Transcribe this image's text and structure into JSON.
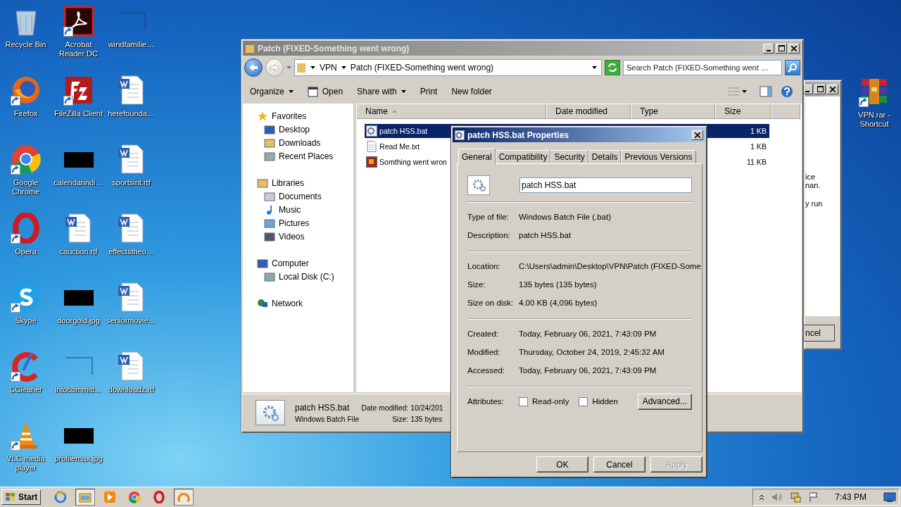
{
  "desktop": {
    "icons": [
      {
        "label": "Recycle Bin",
        "kind": "recycle",
        "shortcut": false
      },
      {
        "label": "Firefox",
        "kind": "firefox",
        "shortcut": true
      },
      {
        "label": "Google Chrome",
        "kind": "chrome",
        "shortcut": true
      },
      {
        "label": "Opera",
        "kind": "opera",
        "shortcut": true
      },
      {
        "label": "Skype",
        "kind": "skype",
        "shortcut": true
      },
      {
        "label": "CCleaner",
        "kind": "ccleaner",
        "shortcut": true
      },
      {
        "label": "VLC media player",
        "kind": "vlc",
        "shortcut": true
      },
      {
        "label": "Acrobat Reader DC",
        "kind": "acrobat",
        "shortcut": true
      },
      {
        "label": "FileZilla Client",
        "kind": "filezilla",
        "shortcut": true
      },
      {
        "label": "calendarindi…",
        "kind": "image",
        "shortcut": false
      },
      {
        "label": "cauction.rtf",
        "kind": "word",
        "shortcut": false
      },
      {
        "label": "doorgold.jpg",
        "kind": "image",
        "shortcut": false
      },
      {
        "label": "intocommitt…",
        "kind": "blank",
        "shortcut": false
      },
      {
        "label": "profilemax.jpg",
        "kind": "image",
        "shortcut": false
      },
      {
        "label": "windfamilie…",
        "kind": "blank",
        "shortcut": false
      },
      {
        "label": "herefounda…",
        "kind": "word",
        "shortcut": false
      },
      {
        "label": "sportsint.rtf",
        "kind": "word",
        "shortcut": false
      },
      {
        "label": "effectstheo…",
        "kind": "word",
        "shortcut": false
      },
      {
        "label": "seniormovie…",
        "kind": "word",
        "shortcut": false
      },
      {
        "label": "downloadz.rtf",
        "kind": "word",
        "shortcut": false
      }
    ],
    "right_icons": [
      {
        "label": "VPN.rar - Shortcut",
        "kind": "winrar",
        "shortcut": true
      }
    ]
  },
  "background_window": {
    "paragraphs": [
      [
        "ice",
        "nan."
      ],
      [
        "y run"
      ]
    ],
    "button": "ncel"
  },
  "explorer": {
    "title": "Patch (FIXED-Something went wrong)",
    "breadcrumb": [
      "VPN",
      "Patch (FIXED-Something went wrong)"
    ],
    "search": {
      "placeholder": "Search Patch (FIXED-Something went …"
    },
    "toolbar": [
      {
        "label": "Organize",
        "kind": "menu"
      },
      {
        "label": "Open",
        "kind": "icon"
      },
      {
        "label": "Share with",
        "kind": "menu"
      },
      {
        "label": "Print",
        "kind": "plain"
      },
      {
        "label": "New folder",
        "kind": "plain"
      }
    ],
    "nav": [
      {
        "label": "Favorites",
        "kind": "star",
        "children": [
          {
            "label": "Desktop",
            "kind": "desktop"
          },
          {
            "label": "Downloads",
            "kind": "downloads"
          },
          {
            "label": "Recent Places",
            "kind": "recent"
          }
        ]
      },
      {
        "label": "Libraries",
        "kind": "libraries",
        "children": [
          {
            "label": "Documents",
            "kind": "documents"
          },
          {
            "label": "Music",
            "kind": "music"
          },
          {
            "label": "Pictures",
            "kind": "pictures"
          },
          {
            "label": "Videos",
            "kind": "videos"
          }
        ]
      },
      {
        "label": "Computer",
        "kind": "computer",
        "children": [
          {
            "label": "Local Disk (C:)",
            "kind": "disk"
          }
        ]
      },
      {
        "label": "Network",
        "kind": "network"
      }
    ],
    "columns": [
      {
        "label": "Name",
        "sorted": true
      },
      {
        "label": "Date modified",
        "sorted": false
      },
      {
        "label": "Type",
        "sorted": false
      },
      {
        "label": "Size",
        "sorted": false
      }
    ],
    "files": [
      {
        "name": "patch HSS.bat",
        "size": "1 KB",
        "kind": "batch",
        "selected": true
      },
      {
        "name": "Read Me.txt",
        "size": "1 KB",
        "kind": "text",
        "selected": false
      },
      {
        "name": "Somthing went wron",
        "size": "11 KB",
        "kind": "media",
        "selected": false
      }
    ],
    "details": {
      "name": "patch HSS.bat",
      "type": "Windows Batch File",
      "fields": [
        {
          "label": "Date modified:",
          "value": "10/24/201"
        },
        {
          "label": "Size:",
          "value": "135 bytes"
        }
      ]
    }
  },
  "dialog": {
    "title": "patch HSS.bat Properties",
    "tabs": [
      {
        "label": "General",
        "selected": true
      },
      {
        "label": "Compatibility",
        "selected": false
      },
      {
        "label": "Security",
        "selected": false
      },
      {
        "label": "Details",
        "selected": false
      },
      {
        "label": "Previous Versions",
        "selected": false
      }
    ],
    "filename": "patch HSS.bat",
    "groups": [
      [
        {
          "label": "Type of file:",
          "value": "Windows Batch File (.bat)"
        },
        {
          "label": "Description:",
          "value": "patch HSS.bat"
        }
      ],
      [
        {
          "label": "Location:",
          "value": "C:\\Users\\admin\\Desktop\\VPN\\Patch (FIXED-Some"
        },
        {
          "label": "Size:",
          "value": "135 bytes (135 bytes)"
        },
        {
          "label": "Size on disk:",
          "value": "4.00 KB (4,096 bytes)"
        }
      ],
      [
        {
          "label": "Created:",
          "value": "Today, February 06, 2021, 7:43:09 PM"
        },
        {
          "label": "Modified:",
          "value": "Thursday, October 24, 2019, 2:45:32 AM"
        },
        {
          "label": "Accessed:",
          "value": "Today, February 06, 2021, 7:43:09 PM"
        }
      ]
    ],
    "attributes": {
      "label": "Attributes:",
      "checks": [
        {
          "label": "Read-only",
          "checked": false
        },
        {
          "label": "Hidden",
          "checked": false
        }
      ],
      "button": "Advanced..."
    },
    "buttons": [
      {
        "label": "OK",
        "disabled": false
      },
      {
        "label": "Cancel",
        "disabled": false
      },
      {
        "label": "Apply",
        "disabled": true
      }
    ]
  },
  "taskbar": {
    "start": "Start",
    "apps": [
      {
        "kind": "ie",
        "selected": false
      },
      {
        "kind": "explorer",
        "selected": true
      },
      {
        "kind": "player",
        "selected": false
      },
      {
        "kind": "chrome",
        "selected": false
      },
      {
        "kind": "opera",
        "selected": false
      },
      {
        "kind": "ring",
        "selected": true
      }
    ],
    "clock": "7:43 PM"
  }
}
